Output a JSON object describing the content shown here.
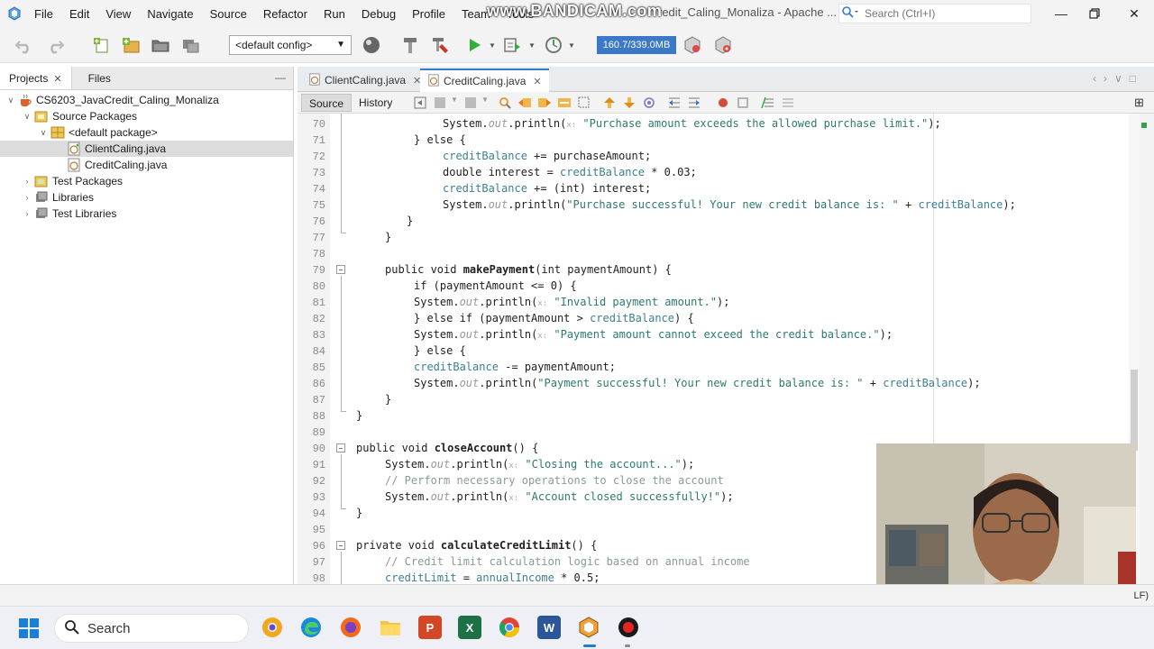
{
  "menu": {
    "items": [
      "File",
      "Edit",
      "View",
      "Navigate",
      "Source",
      "Refactor",
      "Run",
      "Debug",
      "Profile",
      "Team",
      "Tools"
    ],
    "window_title": "redit_Caling_Monaliza - Apache ...",
    "watermark": "www.BANDICAM.com",
    "search_placeholder": "Search (Ctrl+I)"
  },
  "toolbar": {
    "config_value": "<default config>",
    "memory": "160.7/339.0MB"
  },
  "projects_panel": {
    "tabs": [
      "Projects",
      "Files"
    ],
    "tree": [
      {
        "label": "CS6203_JavaCredit_Caling_Monaliza",
        "icon": "java-project-icon"
      },
      {
        "label": "Source Packages",
        "icon": "source-packages-icon"
      },
      {
        "label": "<default package>",
        "icon": "package-icon"
      },
      {
        "label": "ClientCaling.java",
        "icon": "java-file-icon"
      },
      {
        "label": "CreditCaling.java",
        "icon": "java-file-icon"
      },
      {
        "label": "Test Packages",
        "icon": "test-packages-icon"
      },
      {
        "label": "Libraries",
        "icon": "libraries-icon"
      },
      {
        "label": "Test Libraries",
        "icon": "test-libraries-icon"
      }
    ]
  },
  "editor": {
    "tabs": [
      "ClientCaling.java",
      "CreditCaling.java"
    ],
    "view_buttons": [
      "Source",
      "History"
    ],
    "line_numbers": [
      "70",
      "71",
      "72",
      "73",
      "74",
      "75",
      "76",
      "77",
      "78",
      "79",
      "80",
      "81",
      "82",
      "83",
      "84",
      "85",
      "86",
      "87",
      "88",
      "89",
      "90",
      "91",
      "92",
      "93",
      "94",
      "95",
      "96",
      "97",
      "98"
    ]
  },
  "code": {
    "l70_a": "System.",
    "out": "out",
    "l70_b": ".println(",
    "hint_x": "x:",
    "l70_str": "\"Purchase amount exceeds the allowed purchase limit.\"",
    "end_stmt": ");",
    "l71": "} else {",
    "l72_f": "creditBalance",
    "l72_rest": " += purchaseAmount;",
    "l73_a": "double interest = ",
    "l73_f": "creditBalance",
    "l73_rest": " * 0.03;",
    "l74_f": "creditBalance",
    "l74_rest": " += (int) interest;",
    "l75_str": "\"Purchase successful! Your new credit balance is: \"",
    "plus": " + ",
    "l76": "}",
    "l77": "}",
    "l79_a": "public void ",
    "l79_name": "makePayment",
    "l79_rest": "(int paymentAmount) {",
    "l80": "if (paymentAmount <= 0) {",
    "l81_str": "\"Invalid payment amount.\"",
    "l82_a": "} else if (paymentAmount > ",
    "l82_f": "creditBalance",
    "l82_rest": ") {",
    "l83_str": "\"Payment amount cannot exceed the credit balance.\"",
    "l84": "} else {",
    "l85_f": "creditBalance",
    "l85_rest": " -= paymentAmount;",
    "l86_str": "\"Payment successful! Your new credit balance is: \"",
    "l87": "}",
    "l88": "}",
    "l90_a": "public void ",
    "l90_name": "closeAccount",
    "l90_rest": "() {",
    "l91_str": "\"Closing the account...\"",
    "l92": "// Perform necessary operations to close the account",
    "l93_str": "\"Account closed successfully!\"",
    "l94": "}",
    "l96_a": "private void ",
    "l96_name": "calculateCreditLimit",
    "l96_rest": "() {",
    "l97": "// Credit limit calculation logic based on annual income",
    "l98_f1": "creditLimit",
    "l98_eq": " = ",
    "l98_f2": "annualIncome",
    "l98_rest": " * 0.5;"
  },
  "status": {
    "right_text": "LF)"
  },
  "taskbar": {
    "search_label": "Search"
  },
  "colors": {
    "accent": "#3b78c6",
    "field": "#3d7f8f",
    "string": "#2d7a6e",
    "comment": "#8a9a9a"
  }
}
